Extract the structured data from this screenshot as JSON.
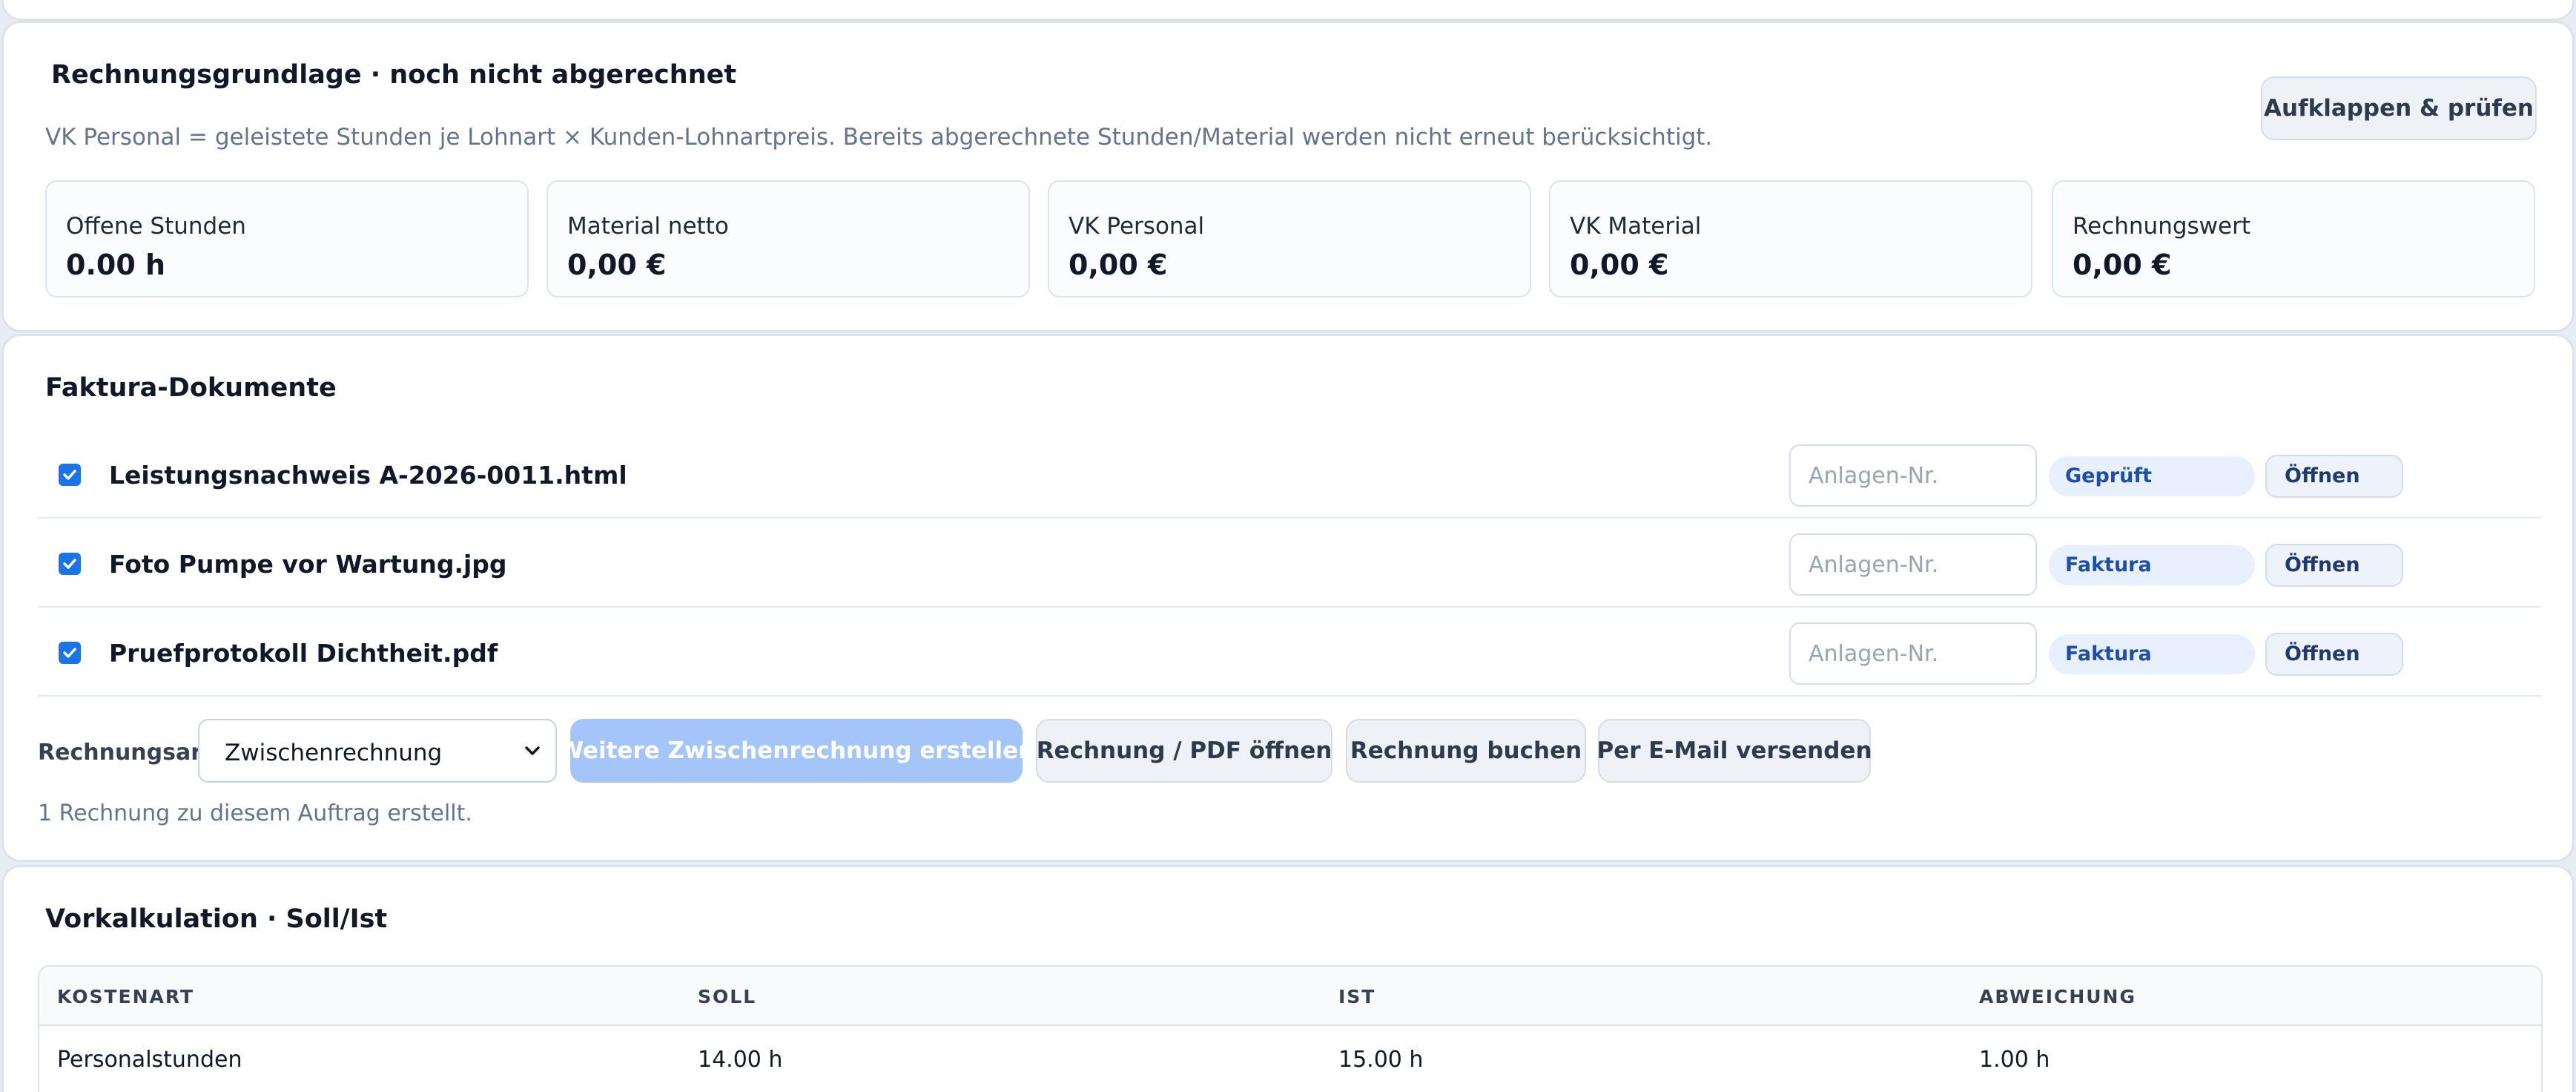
{
  "basis": {
    "title": "Rechnungsgrundlage · noch nicht abgerechnet",
    "description": "VK Personal = geleistete Stunden je Lohnart × Kunden-Lohnartpreis. Bereits abgerechnete Stunden/Material werden nicht erneut berücksichtigt.",
    "expand_button": "Aufklappen & prüfen",
    "stats": [
      {
        "label": "Offene Stunden",
        "value": "0.00 h"
      },
      {
        "label": "Material netto",
        "value": "0,00 €"
      },
      {
        "label": "VK Personal",
        "value": "0,00 €"
      },
      {
        "label": "VK Material",
        "value": "0,00 €"
      },
      {
        "label": "Rechnungswert",
        "value": "0,00 €"
      }
    ]
  },
  "docs": {
    "title": "Faktura-Dokumente",
    "anlagen_placeholder": "Anlagen-Nr.",
    "open_label": "Öffnen",
    "items": [
      {
        "name": "Leistungsnachweis A-2026-0011.html",
        "status": "Geprüft",
        "checked": true
      },
      {
        "name": "Foto Pumpe vor Wartung.jpg",
        "status": "Faktura",
        "checked": true
      },
      {
        "name": "Pruefprotokoll Dichtheit.pdf",
        "status": "Faktura",
        "checked": true
      }
    ],
    "invoice_type_label": "Rechnungsart",
    "invoice_type_value": "Zwischenrechnung",
    "buttons": {
      "create": "Weitere Zwischenrechnung erstellen",
      "open_pdf": "Rechnung / PDF öffnen",
      "book": "Rechnung buchen",
      "email": "Per E-Mail versenden"
    },
    "info": "1 Rechnung zu diesem Auftrag erstellt."
  },
  "calc": {
    "title": "Vorkalkulation · Soll/Ist",
    "columns": [
      "KOSTENART",
      "SOLL",
      "IST",
      "ABWEICHUNG"
    ],
    "rows": [
      [
        "Personalstunden",
        "14.00 h",
        "15.00 h",
        "1.00 h"
      ]
    ]
  },
  "colors": {
    "primary_button": "#a3c5f9",
    "badge_text": "#1e4fa8",
    "checkbox": "#1a73e8"
  }
}
